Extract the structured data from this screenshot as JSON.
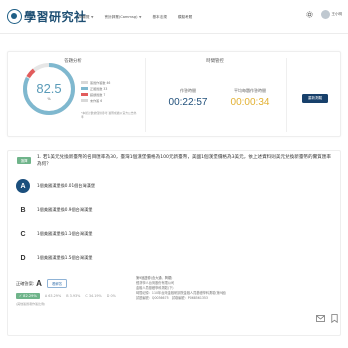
{
  "header": {
    "logo_text": "學習研究社",
    "nav": [
      {
        "label": "QA總覽",
        "dropdown": true
      },
      {
        "label": "會計師業(Cammsg)",
        "dropdown": true
      },
      {
        "label": "基本法規",
        "dropdown": false
      },
      {
        "label": "模擬考題",
        "dropdown": false
      }
    ],
    "user_name": "王小明"
  },
  "stats": {
    "score_title": "答題分析",
    "time_title": "時間管控",
    "gauge_value": "82.5",
    "gauge_unit": "%",
    "gauge_fraction": 0.825,
    "legend": [
      {
        "label": "答題作答數 46",
        "color": "#d9d9d9"
      },
      {
        "label": "正確題數 33",
        "color": "#7fb8cf"
      },
      {
        "label": "錯誤題數 7",
        "color": "#e25c5c"
      },
      {
        "label": "未作答 6",
        "color": "#d9d9d9"
      }
    ],
    "note": "*本統計數據僅供參考,實際成績以官方公告為準",
    "time_used_label": "作答時間",
    "time_used": "00:22:57",
    "time_avg_label": "平均每題作答時間",
    "time_avg": "00:00:34",
    "action_label": "重新測驗"
  },
  "question": {
    "tag": "選擇",
    "text": "1. 若1美元兌換新臺幣的名目匯率為30，臺灣1個漢堡價格為100元新臺幣，美國1個漢堡價格為3美元，依上述資料則美元兌換新臺幣的實質匯率為何？",
    "options": [
      {
        "letter": "A",
        "text": "1個美國漢堡換0.01個台灣漢堡",
        "selected": true
      },
      {
        "letter": "B",
        "text": "1個美國漢堡換0.9個台灣漢堡",
        "selected": false
      },
      {
        "letter": "C",
        "text": "1個美國漢堡換1.1個台灣漢堡",
        "selected": false
      },
      {
        "letter": "D",
        "text": "1個美國漢堡換1.5個台灣漢堡",
        "selected": false
      }
    ],
    "answer_label": "正確答案:",
    "answer_letter": "A",
    "explain_label": "看解答",
    "pct_correct": "✓ 82.29%",
    "pct_others": [
      "A 63.29%",
      "B 3.93%",
      "C 34.19%",
      "D 0%"
    ],
    "answer_note": "(其他答題者作答比例)",
    "source_title": "第9屆證券(含大通、興櫃)",
    "source_lines": [
      "經濟學人台灣股份有限公司",
      "金融人員基礎學科測驗(下)",
      "時間紀錄：110年台灣金融研訓院金融人員基礎學科測驗(第9屆)",
      "試題編號：Q0036675　試卷編號：P068561353"
    ]
  }
}
